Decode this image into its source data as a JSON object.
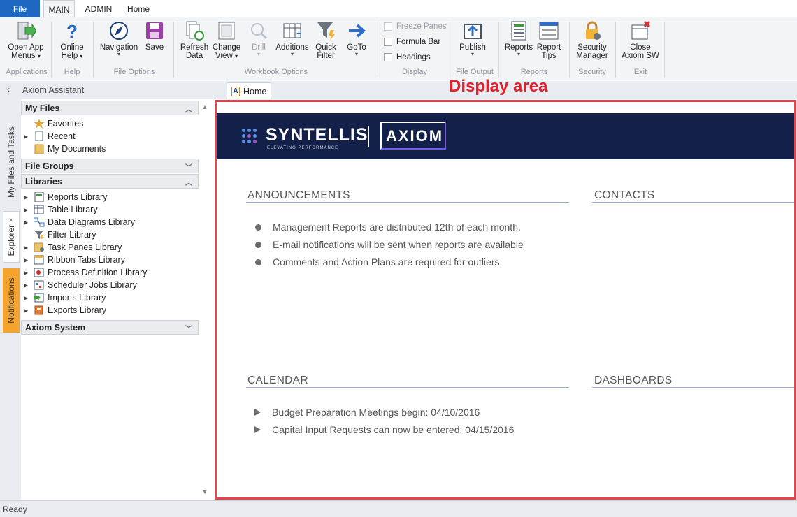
{
  "tabs": [
    {
      "label": "File"
    },
    {
      "label": "MAIN"
    },
    {
      "label": "ADMIN"
    },
    {
      "label": "Home"
    }
  ],
  "ribbon": {
    "open_app": {
      "line1": "Open App",
      "line2": "Menus"
    },
    "online_help": {
      "line1": "Online",
      "line2": "Help"
    },
    "navigation": {
      "label": "Navigation"
    },
    "save": {
      "label": "Save"
    },
    "refresh": {
      "line1": "Refresh",
      "line2": "Data"
    },
    "change_view": {
      "line1": "Change",
      "line2": "View"
    },
    "drill": {
      "label": "Drill"
    },
    "additions": {
      "label": "Additions"
    },
    "quick_filter": {
      "line1": "Quick",
      "line2": "Filter"
    },
    "goto": {
      "label": "GoTo"
    },
    "freeze_panes": {
      "label": "Freeze Panes"
    },
    "formula_bar": {
      "label": "Formula Bar"
    },
    "headings": {
      "label": "Headings"
    },
    "publish": {
      "label": "Publish"
    },
    "reports": {
      "label": "Reports"
    },
    "report_tips": {
      "line1": "Report",
      "line2": "Tips"
    },
    "security_manager": {
      "line1": "Security",
      "line2": "Manager"
    },
    "close_axiom": {
      "line1": "Close",
      "line2": "Axiom SW"
    },
    "groups": {
      "applications": "Applications",
      "help": "Help",
      "file_options": "File Options",
      "workbook_options": "Workbook Options",
      "display": "Display",
      "file_output": "File Output",
      "reports": "Reports",
      "security": "Security",
      "exit": "Exit"
    }
  },
  "assistant": {
    "title": "Axiom Assistant"
  },
  "doc_tab": {
    "label": "Home"
  },
  "display_area_label": "Display area",
  "side_tabs": {
    "files": "My Files and Tasks",
    "explorer": "Explorer",
    "explorer_close": "×",
    "notifications": "Notifications"
  },
  "explorer": {
    "my_files": {
      "title": "My Files",
      "items": [
        "Favorites",
        "Recent",
        "My Documents"
      ]
    },
    "file_groups": {
      "title": "File Groups"
    },
    "libraries": {
      "title": "Libraries",
      "items": [
        "Reports Library",
        "Table Library",
        "Data Diagrams Library",
        "Filter Library",
        "Task Panes Library",
        "Ribbon Tabs Library",
        "Process Definition Library",
        "Scheduler Jobs Library",
        "Imports Library",
        "Exports Library"
      ]
    },
    "axiom_system": {
      "title": "Axiom System"
    }
  },
  "banner": {
    "brand": "SYNTELLIS",
    "tagline": "ELEVATING PERFORMANCE",
    "product": "AXIOM"
  },
  "announcements": {
    "title": "ANNOUNCEMENTS",
    "items": [
      "Management Reports are distributed 12th of each month.",
      "E-mail notifications will be sent when reports are available",
      "Comments and Action Plans are required for outliers"
    ]
  },
  "contacts": {
    "title": "CONTACTS"
  },
  "calendar": {
    "title": "CALENDAR",
    "items": [
      "Budget Preparation Meetings begin: 04/10/2016",
      "Capital Input Requests can now be entered: 04/15/2016"
    ]
  },
  "dashboards": {
    "title": "DASHBOARDS"
  },
  "status": {
    "text": "Ready"
  },
  "colors": {
    "file_tab": "#1e67c2",
    "banner": "#13204a",
    "display_border": "#e8424a",
    "notifications_tab": "#f3a32e"
  }
}
